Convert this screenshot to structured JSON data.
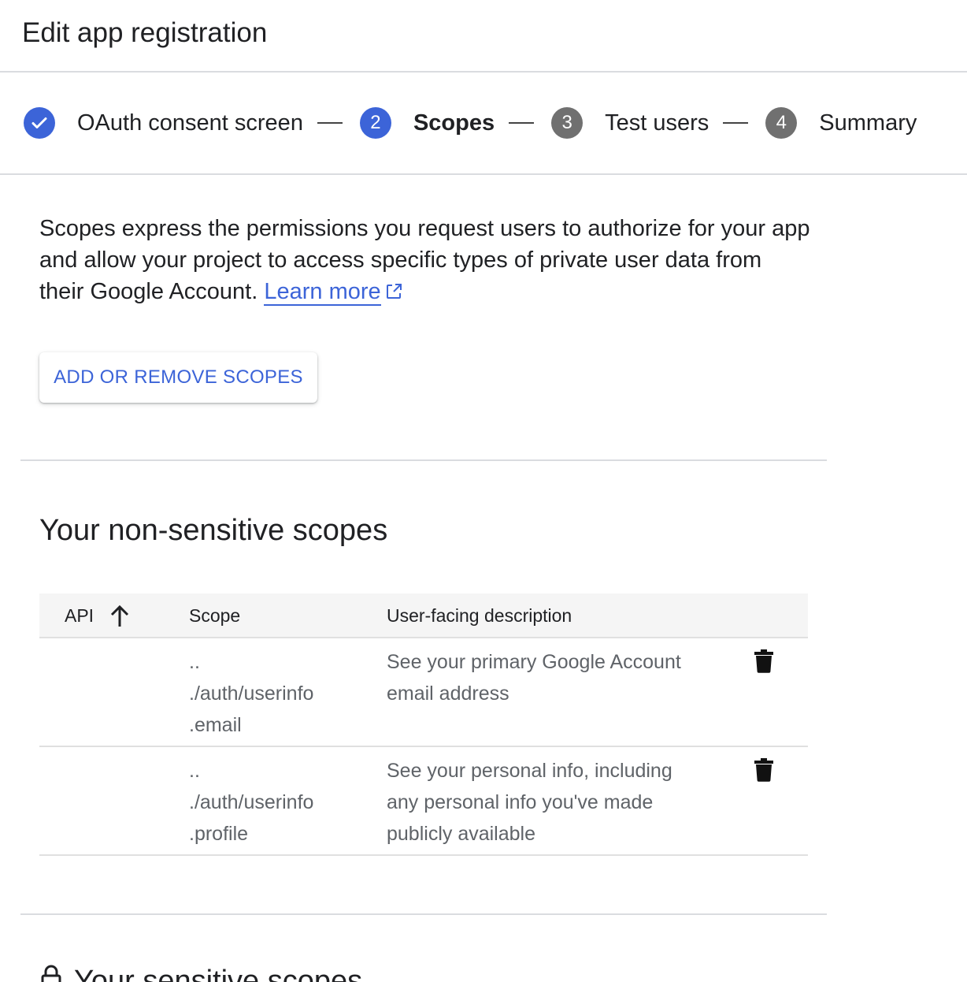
{
  "header": {
    "title": "Edit app registration"
  },
  "stepper": {
    "steps": [
      {
        "number": "",
        "label": "OAuth consent screen",
        "state": "done"
      },
      {
        "number": "2",
        "label": "Scopes",
        "state": "active"
      },
      {
        "number": "3",
        "label": "Test users",
        "state": "pending"
      },
      {
        "number": "4",
        "label": "Summary",
        "state": "pending"
      }
    ]
  },
  "intro": {
    "text": "Scopes express the permissions you request users to authorize for your app and allow your project to access specific types of private user data from their Google Account. ",
    "link_label": "Learn more"
  },
  "actions": {
    "add_remove_label": "ADD OR REMOVE SCOPES"
  },
  "non_sensitive": {
    "title": "Your non-sensitive scopes",
    "columns": {
      "api": "API",
      "scope": "Scope",
      "description": "User-facing description"
    },
    "rows": [
      {
        "scope_lines": [
          "..",
          "./auth/userinfo",
          ".email"
        ],
        "description_lines": [
          "See your primary Google Account",
          "email address"
        ]
      },
      {
        "scope_lines": [
          "..",
          "./auth/userinfo",
          ".profile"
        ],
        "description_lines": [
          "See your personal info, including",
          "any personal info you've made",
          "publicly available"
        ]
      }
    ]
  },
  "sensitive": {
    "title": "Your sensitive scopes"
  },
  "colors": {
    "accent": "#3c64d8",
    "pending_step": "#707070",
    "divider": "#dadce0"
  }
}
